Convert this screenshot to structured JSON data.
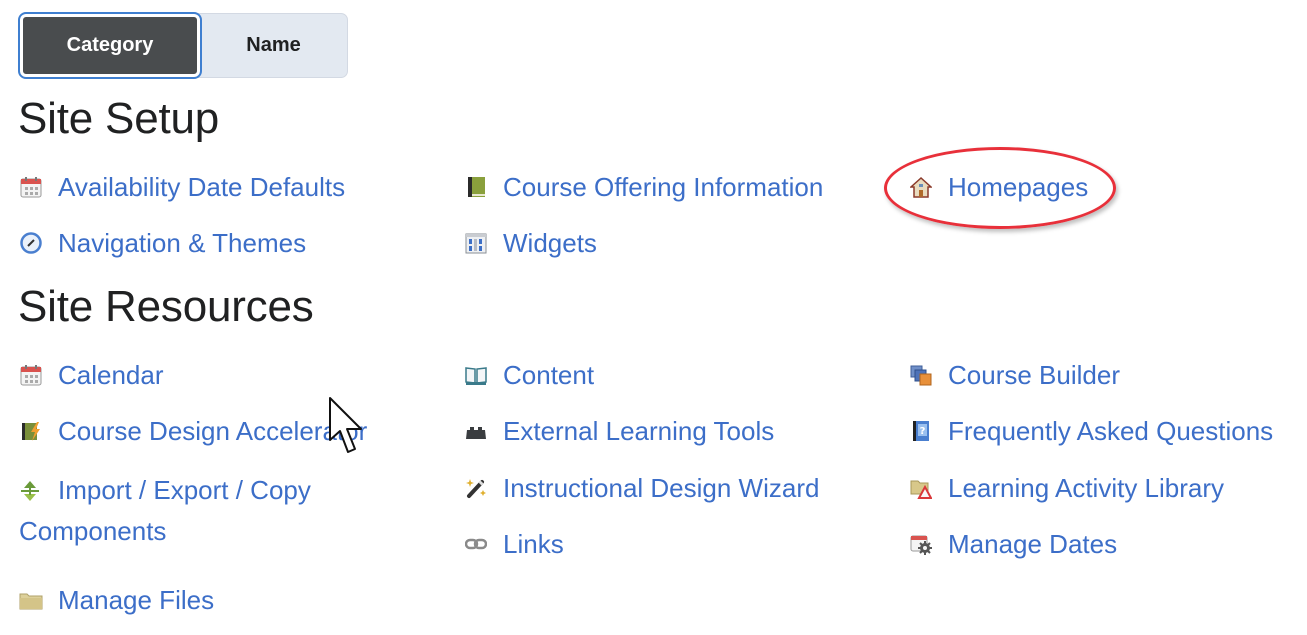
{
  "view_toggle": {
    "options": [
      {
        "label": "Category",
        "selected": true
      },
      {
        "label": "Name",
        "selected": false
      }
    ]
  },
  "sections": [
    {
      "title": "Site Setup",
      "items": [
        {
          "label": "Availability Date Defaults",
          "icon": "calendar-icon"
        },
        {
          "label": "Course Offering Information",
          "icon": "green-book-icon"
        },
        {
          "label": "Homepages",
          "icon": "house-icon",
          "highlighted": true
        },
        {
          "label": "Navigation & Themes",
          "icon": "compass-icon"
        },
        {
          "label": "Widgets",
          "icon": "widgets-icon"
        }
      ]
    },
    {
      "title": "Site Resources",
      "items": [
        {
          "label": "Calendar",
          "icon": "calendar-icon"
        },
        {
          "label": "Content",
          "icon": "open-book-icon"
        },
        {
          "label": "Course Builder",
          "icon": "stacked-cubes-icon"
        },
        {
          "label": "Course Design Accelerator",
          "icon": "book-lightning-icon"
        },
        {
          "label": "External Learning Tools",
          "icon": "puzzle-brick-icon"
        },
        {
          "label": "Frequently Asked Questions",
          "icon": "faq-book-icon"
        },
        {
          "label": "Import / Export / Copy Components",
          "icon": "import-export-icon"
        },
        {
          "label": "Instructional Design Wizard",
          "icon": "magic-wand-icon"
        },
        {
          "label": "Learning Activity Library",
          "icon": "folder-warning-icon"
        },
        {
          "label": "Links",
          "icon": "chain-link-icon"
        },
        {
          "label": "Manage Dates",
          "icon": "calendar-gear-icon"
        },
        {
          "label": "Manage Files",
          "icon": "folder-icon"
        }
      ]
    }
  ],
  "colors": {
    "link": "#3c6ec8",
    "heading": "#202122",
    "toggle_active_bg": "#494c4e",
    "toggle_inactive_bg": "#e3e9f1",
    "highlight_ring": "#e8303a"
  }
}
